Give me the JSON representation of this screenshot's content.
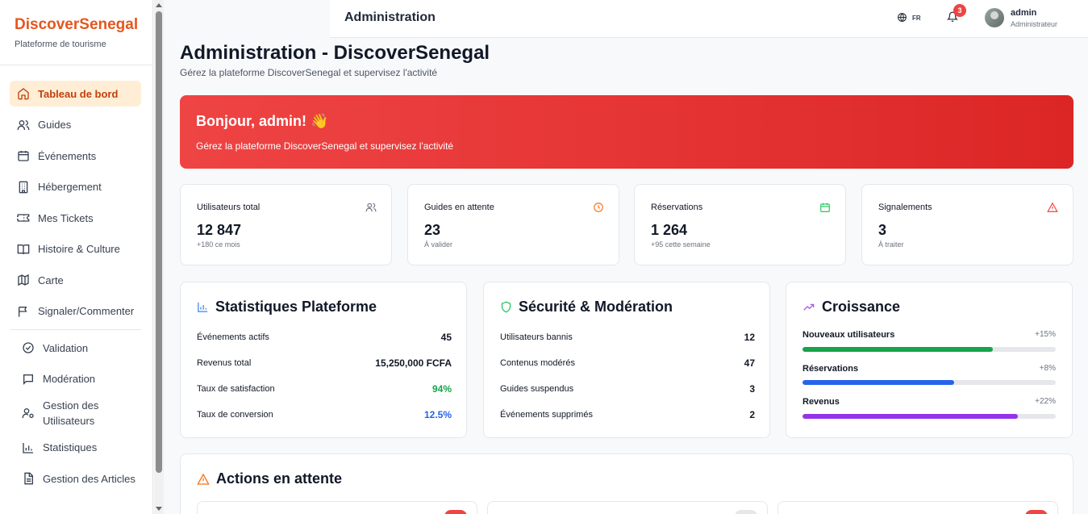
{
  "brand": {
    "name": "DiscoverSenegal",
    "tagline": "Plateforme de tourisme"
  },
  "sidebar": {
    "items": [
      {
        "label": "Tableau de bord",
        "icon": "home-icon",
        "active": true
      },
      {
        "label": "Guides",
        "icon": "users-icon"
      },
      {
        "label": "Événements",
        "icon": "calendar-icon"
      },
      {
        "label": "Hébergement",
        "icon": "building-icon"
      },
      {
        "label": "Mes Tickets",
        "icon": "ticket-icon"
      },
      {
        "label": "Histoire & Culture",
        "icon": "book-icon"
      },
      {
        "label": "Carte",
        "icon": "map-icon"
      },
      {
        "label": "Signaler/Commenter",
        "icon": "flag-icon"
      }
    ],
    "admin_items": [
      {
        "label": "Validation",
        "icon": "check-circle-icon"
      },
      {
        "label": "Modération",
        "icon": "message-icon"
      },
      {
        "label": "Gestion des Utilisateurs",
        "icon": "user-cog-icon"
      },
      {
        "label": "Statistiques",
        "icon": "bar-chart-icon"
      },
      {
        "label": "Gestion des Articles",
        "icon": "file-text-icon"
      }
    ]
  },
  "header": {
    "title": "Administration",
    "language": "FR",
    "notifications_count": "3",
    "user": {
      "name": "admin",
      "role": "Administrateur"
    }
  },
  "page": {
    "title": "Administration - DiscoverSenegal",
    "subtitle": "Gérez la plateforme DiscoverSenegal et supervisez l'activité"
  },
  "hero": {
    "greeting": "Bonjour, admin! 👋",
    "text": "Gérez la plateforme DiscoverSenegal et supervisez l'activité",
    "color_from": "#ef4444",
    "color_to": "#dc2626"
  },
  "stats": [
    {
      "label": "Utilisateurs total",
      "value": "12 847",
      "note": "+180 ce mois",
      "icon": "users-icon",
      "color": "#6b7280"
    },
    {
      "label": "Guides en attente",
      "value": "23",
      "note": "À valider",
      "icon": "clock-icon",
      "color": "#f97316"
    },
    {
      "label": "Réservations",
      "value": "1 264",
      "note": "+95 cette semaine",
      "icon": "calendar-icon",
      "color": "#22c55e"
    },
    {
      "label": "Signalements",
      "value": "3",
      "note": "À traiter",
      "icon": "alert-triangle-icon",
      "color": "#ef4444"
    }
  ],
  "platform_stats": {
    "title": "Statistiques Plateforme",
    "rows": [
      {
        "label": "Événements actifs",
        "value": "45"
      },
      {
        "label": "Revenus total",
        "value": "15,250,000 FCFA"
      },
      {
        "label": "Taux de satisfaction",
        "value": "94%"
      },
      {
        "label": "Taux de conversion",
        "value": "12.5%"
      }
    ]
  },
  "security": {
    "title": "Sécurité & Modération",
    "rows": [
      {
        "label": "Utilisateurs bannis",
        "value": "12"
      },
      {
        "label": "Contenus modérés",
        "value": "47"
      },
      {
        "label": "Guides suspendus",
        "value": "3"
      },
      {
        "label": "Événements supprimés",
        "value": "2"
      }
    ]
  },
  "growth": {
    "title": "Croissance",
    "items": [
      {
        "label": "Nouveaux utilisateurs",
        "change": "+15%",
        "level": 0.75,
        "color": "#16a34a"
      },
      {
        "label": "Réservations",
        "change": "+8%",
        "level": 0.6,
        "color": "#2563eb"
      },
      {
        "label": "Revenus",
        "change": "+22%",
        "level": 0.85,
        "color": "#9333ea"
      }
    ]
  },
  "pending": {
    "title": "Actions en attente"
  }
}
